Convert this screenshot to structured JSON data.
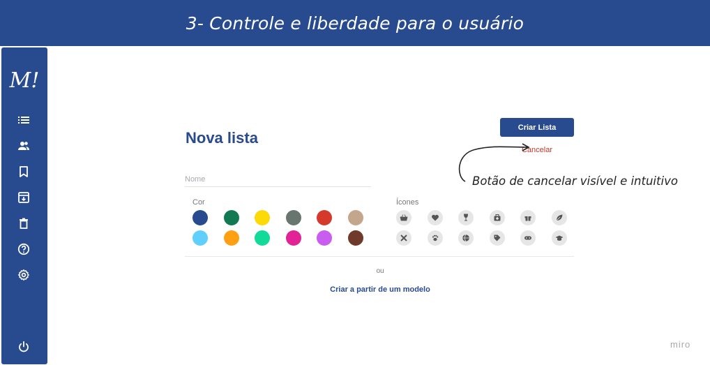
{
  "banner": {
    "title": "3- Controle e liberdade para o usuário"
  },
  "sidebar": {
    "logo": "M!",
    "items": [
      {
        "name": "list-icon"
      },
      {
        "name": "users-icon"
      },
      {
        "name": "bookmark-icon"
      },
      {
        "name": "archive-icon"
      },
      {
        "name": "trash-icon"
      },
      {
        "name": "help-icon"
      },
      {
        "name": "gear-icon"
      }
    ],
    "power": {
      "name": "power-icon"
    }
  },
  "header": {
    "title": "Nova lista",
    "create_label": "Criar Lista",
    "cancel_label": "Cancelar"
  },
  "annotation": {
    "text": "Botão de cancelar visível e intuitivo"
  },
  "form": {
    "name_placeholder": "Nome",
    "color_label": "Cor",
    "icons_label": "Ícones",
    "colors": [
      "#284a8f",
      "#127a53",
      "#fcd908",
      "#68766f",
      "#d5392c",
      "#c4a68c",
      "#61cffc",
      "#ffa012",
      "#12db9a",
      "#e22396",
      "#c85df0",
      "#6f3a2a"
    ],
    "icons": [
      "basket-icon",
      "heart-icon",
      "wine-glass-icon",
      "medical-kit-icon",
      "gift-icon",
      "leaf-icon",
      "tools-icon",
      "paw-icon",
      "ball-icon",
      "tag-icon",
      "gamepad-icon",
      "graduation-cap-icon"
    ]
  },
  "footer": {
    "or_text": "ou",
    "template_label": "Criar a partir de um modelo"
  },
  "watermark": "miro"
}
